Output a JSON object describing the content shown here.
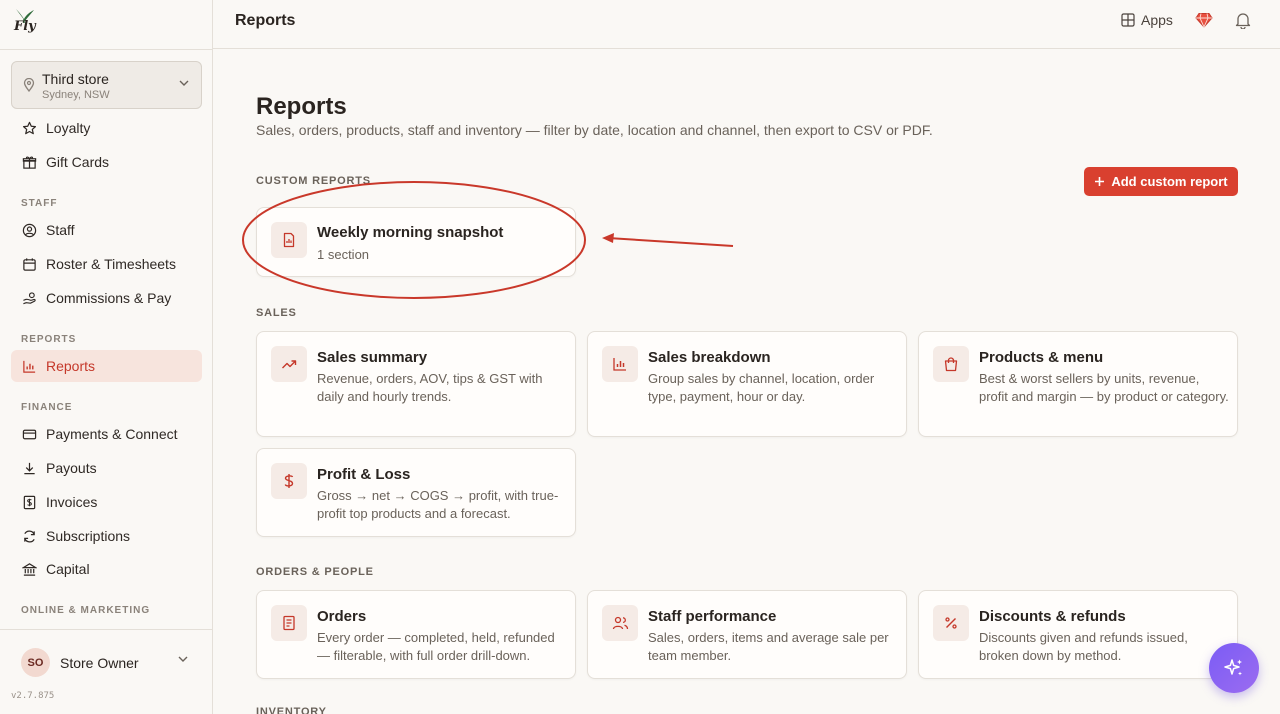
{
  "app": {
    "logo_text": "Fly",
    "version": "v2.7.875"
  },
  "store": {
    "name": "Third store",
    "location": "Sydney, NSW"
  },
  "sidebar": {
    "items_top": [
      {
        "label": "Loyalty",
        "icon": "star-icon"
      },
      {
        "label": "Gift Cards",
        "icon": "gift-icon"
      }
    ],
    "staff_section": "STAFF",
    "staff_items": [
      {
        "label": "Staff",
        "icon": "user-circle-icon"
      },
      {
        "label": "Roster & Timesheets",
        "icon": "calendar-icon"
      },
      {
        "label": "Commissions & Pay",
        "icon": "hand-coins-icon"
      }
    ],
    "reports_section": "REPORTS",
    "reports_items": [
      {
        "label": "Reports",
        "icon": "bar-chart-icon",
        "active": true
      }
    ],
    "finance_section": "FINANCE",
    "finance_items": [
      {
        "label": "Payments & Connect",
        "icon": "credit-card-icon"
      },
      {
        "label": "Payouts",
        "icon": "download-icon"
      },
      {
        "label": "Invoices",
        "icon": "invoice-icon"
      },
      {
        "label": "Subscriptions",
        "icon": "refresh-icon"
      },
      {
        "label": "Capital",
        "icon": "bank-icon"
      }
    ],
    "online_section": "ONLINE & MARKETING"
  },
  "user": {
    "initials": "SO",
    "name": "Store Owner"
  },
  "topbar": {
    "title": "Reports",
    "apps_label": "Apps"
  },
  "page": {
    "title": "Reports",
    "subtitle": "Sales, orders, products, staff and inventory — filter by date, location and channel, then export to CSV or PDF."
  },
  "custom_reports": {
    "label": "CUSTOM REPORTS",
    "add_label": "Add custom report",
    "items": [
      {
        "title": "Weekly morning snapshot",
        "desc": "1 section",
        "icon": "document-icon"
      }
    ]
  },
  "sales": {
    "label": "SALES",
    "items": [
      {
        "title": "Sales summary",
        "desc": "Revenue, orders, AOV, tips & GST with daily and hourly trends.",
        "icon": "trend-up-icon"
      },
      {
        "title": "Sales breakdown",
        "desc": "Group sales by channel, location, order type, payment, hour or day.",
        "icon": "bar-chart-icon"
      },
      {
        "title": "Products & menu",
        "desc": "Best & worst sellers by units, revenue, profit and margin — by product or category.",
        "icon": "shopping-bag-icon"
      },
      {
        "title": "Profit & Loss",
        "desc": "Gross → net → COGS → profit, with true-profit top products and a forecast.",
        "icon": "dollar-icon"
      }
    ]
  },
  "orders_people": {
    "label": "ORDERS & PEOPLE",
    "items": [
      {
        "title": "Orders",
        "desc": "Every order — completed, held, refunded — filterable, with full order drill-down.",
        "icon": "receipt-icon"
      },
      {
        "title": "Staff performance",
        "desc": "Sales, orders, items and average sale per team member.",
        "icon": "users-icon"
      },
      {
        "title": "Discounts & refunds",
        "desc": "Discounts given and refunds issued, broken down by method.",
        "icon": "percent-icon"
      }
    ]
  },
  "inventory": {
    "label": "INVENTORY"
  },
  "colors": {
    "accent": "#d9402f",
    "active_bg": "#f7e4dd",
    "annotation": "#c9382a",
    "fab": "#7b5cf5"
  }
}
